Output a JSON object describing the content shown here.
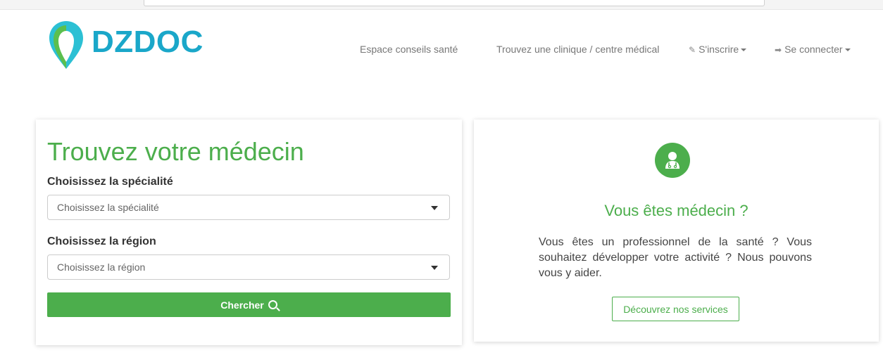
{
  "logo": {
    "text": "DZDOC",
    "color": "#1aa7c9"
  },
  "nav": {
    "items": [
      {
        "label": "Espace conseils santé"
      },
      {
        "label": "Trouvez une clinique / centre médical"
      },
      {
        "label": "S'inscrire",
        "icon": "edit-icon"
      },
      {
        "label": "Se connecter",
        "icon": "sign-in-icon"
      }
    ]
  },
  "search_card": {
    "title": "Trouvez votre médecin",
    "specialty_label": "Choisissez la spécialité",
    "specialty_value": "Choisissez la spécialité",
    "region_label": "Choisissez la région",
    "region_value": "Choisissez la région",
    "button_label": "Chercher"
  },
  "doctor_card": {
    "icon": "doctor-icon",
    "title": "Vous êtes médecin ?",
    "text": "Vous êtes un professionnel de la santé ? Vous souhaitez développer votre activité ? Nous pouvons vous y aider.",
    "button_label": "Découvrez nos services"
  },
  "colors": {
    "accent": "#4cae4c",
    "brand": "#1aa7c9"
  }
}
